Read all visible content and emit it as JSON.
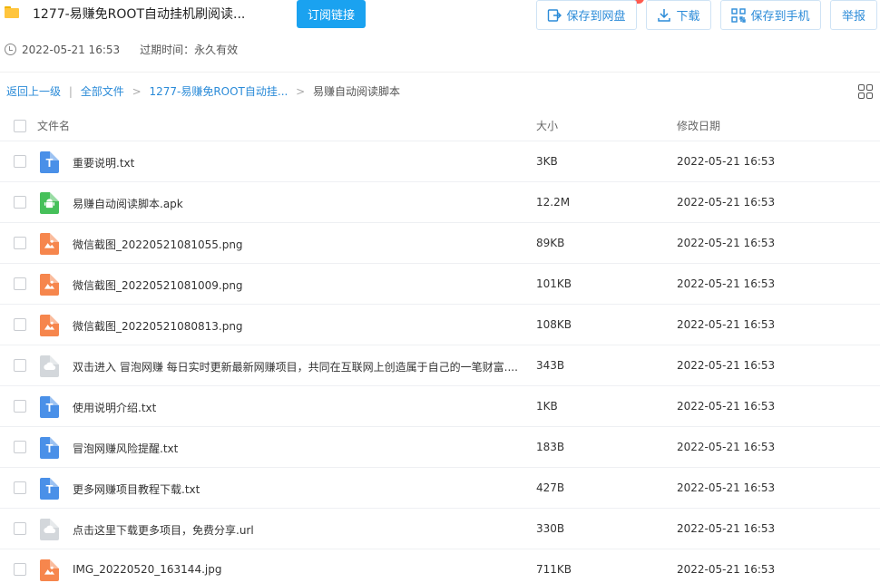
{
  "header": {
    "title": "1277-易赚免ROOT自动挂机刷阅读...",
    "subscribe_label": "订阅链接",
    "save_label": "保存到网盘",
    "download_label": "下载",
    "save_phone_label": "保存到手机",
    "report_label": "举报",
    "created": "2022-05-21 16:53",
    "expire": "过期时间：永久有效"
  },
  "breadcrumb": {
    "back": "返回上一级",
    "sep": "|",
    "all_files": "全部文件",
    "parent": "1277-易赚免ROOT自动挂...",
    "arrow": ">",
    "current": "易赚自动阅读脚本"
  },
  "table": {
    "columns": {
      "name": "文件名",
      "size": "大小",
      "date": "修改日期"
    },
    "rows": [
      {
        "type": "txt",
        "name": "重要说明.txt",
        "size": "3KB",
        "date": "2022-05-21 16:53"
      },
      {
        "type": "apk",
        "name": "易赚自动阅读脚本.apk",
        "size": "12.2M",
        "date": "2022-05-21 16:53"
      },
      {
        "type": "img",
        "name": "微信截图_20220521081055.png",
        "size": "89KB",
        "date": "2022-05-21 16:53"
      },
      {
        "type": "img",
        "name": "微信截图_20220521081009.png",
        "size": "101KB",
        "date": "2022-05-21 16:53"
      },
      {
        "type": "img",
        "name": "微信截图_20220521080813.png",
        "size": "108KB",
        "date": "2022-05-21 16:53"
      },
      {
        "type": "url",
        "name": "双击进入 冒泡网赚 每日实时更新最新网赚项目，共同在互联网上创造属于自己的一笔财富....",
        "size": "343B",
        "date": "2022-05-21 16:53"
      },
      {
        "type": "txt",
        "name": "使用说明介绍.txt",
        "size": "1KB",
        "date": "2022-05-21 16:53"
      },
      {
        "type": "txt",
        "name": "冒泡网赚风险提醒.txt",
        "size": "183B",
        "date": "2022-05-21 16:53"
      },
      {
        "type": "txt",
        "name": "更多网赚项目教程下载.txt",
        "size": "427B",
        "date": "2022-05-21 16:53"
      },
      {
        "type": "url",
        "name": "点击这里下载更多项目，免费分享.url",
        "size": "330B",
        "date": "2022-05-21 16:53"
      },
      {
        "type": "img",
        "name": "IMG_20220520_163144.jpg",
        "size": "711KB",
        "date": "2022-05-21 16:53"
      }
    ]
  },
  "icons": {
    "txt_glyph": "T",
    "txt_color": "#4a90e8",
    "apk_color": "#46c05a",
    "img_color": "#f6864d",
    "url_color": "#d3d7db",
    "accent": "#1aa2f0"
  }
}
